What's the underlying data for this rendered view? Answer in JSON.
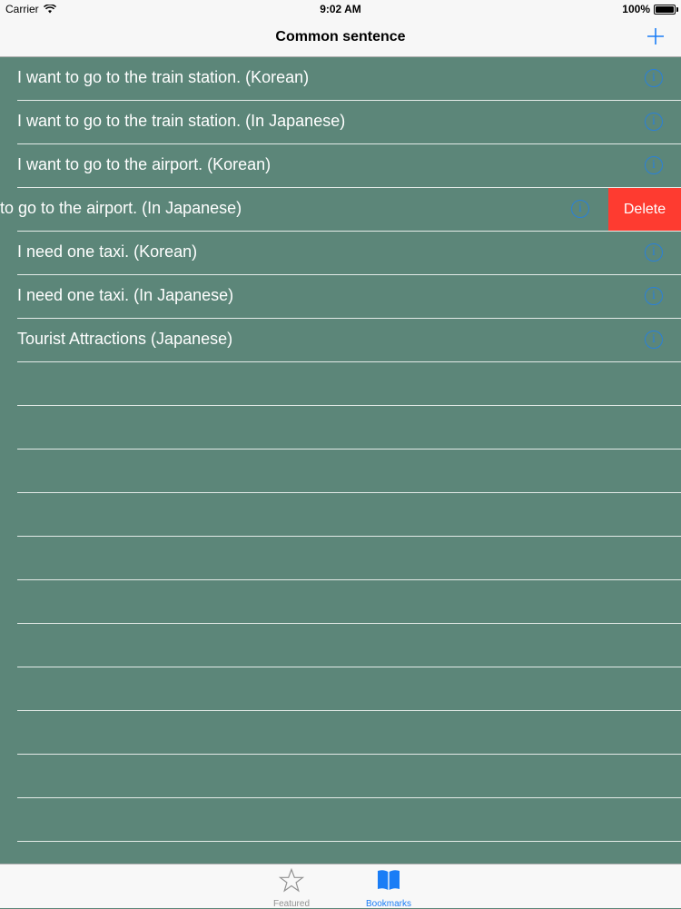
{
  "status": {
    "carrier": "Carrier",
    "time": "9:02 AM",
    "battery": "100%"
  },
  "nav": {
    "title": "Common sentence",
    "add_icon": "plus-icon"
  },
  "rows": [
    {
      "label": "I want to go to the train station. (Korean)"
    },
    {
      "label": "I want to go to the train station. (In Japanese)"
    },
    {
      "label": "I want to go to the airport. (Korean)"
    },
    {
      "label": "to go to the airport. (In Japanese)",
      "swiped": true,
      "delete_label": "Delete"
    },
    {
      "label": "I need one taxi. (Korean)"
    },
    {
      "label": "I need one taxi. (In Japanese)"
    },
    {
      "label": "Tourist Attractions (Japanese)"
    }
  ],
  "tabs": [
    {
      "label": "Featured",
      "icon": "star-icon",
      "selected": false
    },
    {
      "label": "Bookmarks",
      "icon": "book-icon",
      "selected": true
    }
  ],
  "colors": {
    "background": "#5c8679",
    "accent": "#1a7df6",
    "delete": "#fe3b30"
  }
}
